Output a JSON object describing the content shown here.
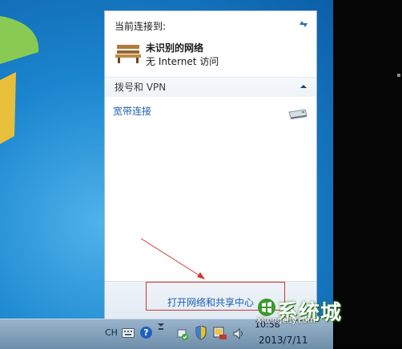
{
  "popup": {
    "connected_to": "当前连接到:",
    "network_name": "未识别的网络",
    "network_status": "无 Internet 访问",
    "dialup_header": "拨号和 VPN",
    "broadband": "宽带连接",
    "open_center": "打开网络和共享中心"
  },
  "taskbar": {
    "language": "CH",
    "help": "?",
    "time": "10:58",
    "date": "2013/7/11"
  },
  "watermark": {
    "text": "系统城",
    "url": "Xitongcity.com"
  },
  "colors": {
    "link": "#1a5fb4",
    "annotation_red": "#d0362b"
  },
  "icons": [
    "refresh-icon",
    "bench-network-icon",
    "collapse-chevron-icon",
    "modem-icon",
    "help-icon",
    "flag-icon",
    "shield-icon",
    "network-icon",
    "volume-icon"
  ]
}
